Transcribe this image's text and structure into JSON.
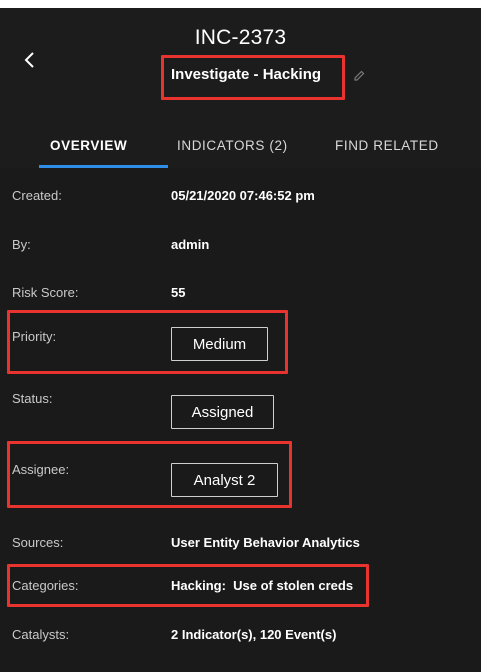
{
  "header": {
    "incident_id": "INC-2373",
    "incident_name": "Investigate - Hacking"
  },
  "tabs": [
    {
      "label": "OVERVIEW",
      "active": true
    },
    {
      "label": "INDICATORS (2)",
      "active": false
    },
    {
      "label": "FIND RELATED",
      "active": false
    }
  ],
  "overview": {
    "created": {
      "label": "Created:",
      "value": "05/21/2020 07:46:52 pm"
    },
    "by": {
      "label": "By:",
      "value": "admin"
    },
    "risk_score": {
      "label": "Risk Score:",
      "value": "55"
    },
    "priority": {
      "label": "Priority:",
      "value": "Medium"
    },
    "status": {
      "label": "Status:",
      "value": "Assigned"
    },
    "assignee": {
      "label": "Assignee:",
      "value": "Analyst 2"
    },
    "sources": {
      "label": "Sources:",
      "value": "User Entity Behavior Analytics"
    },
    "categories": {
      "label": "Categories:",
      "value": "Hacking:  Use of stolen creds"
    },
    "catalysts": {
      "label": "Catalysts:",
      "value": "2 Indicator(s), 120 Event(s)"
    }
  },
  "icons": {
    "back": "chevron-left-icon",
    "edit": "pencil-icon"
  },
  "colors": {
    "background": "#1c1c1c",
    "highlight": "#e8332e",
    "tab_accent": "#2f8ee8"
  }
}
